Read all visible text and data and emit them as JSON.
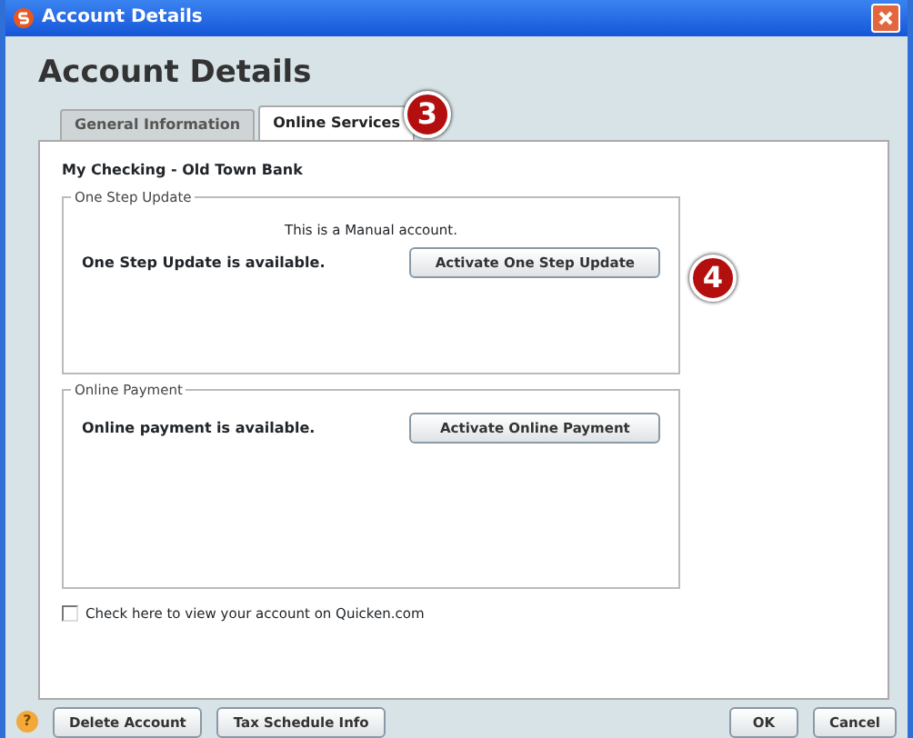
{
  "window": {
    "title": "Account Details"
  },
  "heading": "Account Details",
  "tabs": [
    {
      "label": "General Information",
      "selected": false
    },
    {
      "label": "Online Services",
      "selected": true
    }
  ],
  "callouts": [
    "3",
    "4"
  ],
  "account_name": "My Checking - Old Town Bank",
  "one_step_update": {
    "legend": "One Step Update",
    "note": "This is a Manual account.",
    "status": "One Step Update is available.",
    "button": "Activate One Step Update"
  },
  "online_payment": {
    "legend": "Online Payment",
    "status": "Online payment is available.",
    "button": "Activate Online Payment"
  },
  "checkbox": {
    "label": "Check here to view your account on Quicken.com",
    "checked": false
  },
  "footer": {
    "help": "?",
    "left_buttons": [
      "Delete Account",
      "Tax Schedule Info"
    ],
    "right_buttons": [
      "OK",
      "Cancel"
    ]
  }
}
